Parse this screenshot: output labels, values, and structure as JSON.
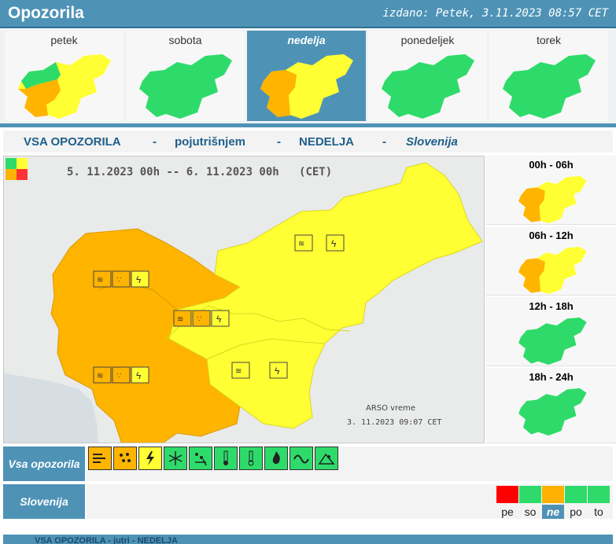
{
  "header": {
    "title": "Opozorila",
    "issued": "izdano: Petek, 3.11.2023 08:57 CET"
  },
  "days": [
    {
      "label": "petek",
      "map": "mixed"
    },
    {
      "label": "sobota",
      "map": "green"
    },
    {
      "label": "nedelja",
      "map": "orange",
      "active": true
    },
    {
      "label": "ponedeljek",
      "map": "green"
    },
    {
      "label": "torek",
      "map": "green"
    }
  ],
  "title_bar": {
    "scope": "VSA OPOZORILA",
    "time": "pojutrišnjem",
    "day": "NEDELJA",
    "region": "Slovenija",
    "sep": "-"
  },
  "main_map": {
    "period": "5. 11.2023  00h  --  6. 11.2023  00h",
    "tz": "(CET)",
    "credit": "ARSO vreme",
    "credit_time": "3. 11.2023  09:07 CET"
  },
  "periods": [
    {
      "label": "00h - 06h",
      "map": "orange"
    },
    {
      "label": "06h - 12h",
      "map": "orange"
    },
    {
      "label": "12h - 18h",
      "map": "green"
    },
    {
      "label": "18h - 24h",
      "map": "green"
    }
  ],
  "types_row": {
    "label": "Vsa opozorila",
    "icons": [
      {
        "name": "wind-icon",
        "level": "orange"
      },
      {
        "name": "rain-icon",
        "level": "orange"
      },
      {
        "name": "thunderstorm-icon",
        "level": "yellow"
      },
      {
        "name": "snow-icon",
        "level": "green"
      },
      {
        "name": "snow-ice-icon",
        "level": "green"
      },
      {
        "name": "high-temperature-icon",
        "level": "green"
      },
      {
        "name": "low-temperature-icon",
        "level": "green"
      },
      {
        "name": "fire-icon",
        "level": "green"
      },
      {
        "name": "coastal-event-icon",
        "level": "green"
      },
      {
        "name": "avalanche-icon",
        "level": "green"
      }
    ]
  },
  "region_row": {
    "label": "Slovenija",
    "days": [
      {
        "label": "pe",
        "color": "#ff0000"
      },
      {
        "label": "so",
        "color": "#2edb6a"
      },
      {
        "label": "ne",
        "color": "#ffb000",
        "active": true
      },
      {
        "label": "po",
        "color": "#2edb6a"
      },
      {
        "label": "to",
        "color": "#2edb6a"
      }
    ]
  },
  "footer": {
    "text": "VSA OPOZORILA - jutri - NEDELJA"
  },
  "colors": {
    "accent": "#4e93b6",
    "green": "#2edb6a",
    "yellow": "#ffff33",
    "orange": "#ffb400",
    "red": "#ff2222"
  }
}
